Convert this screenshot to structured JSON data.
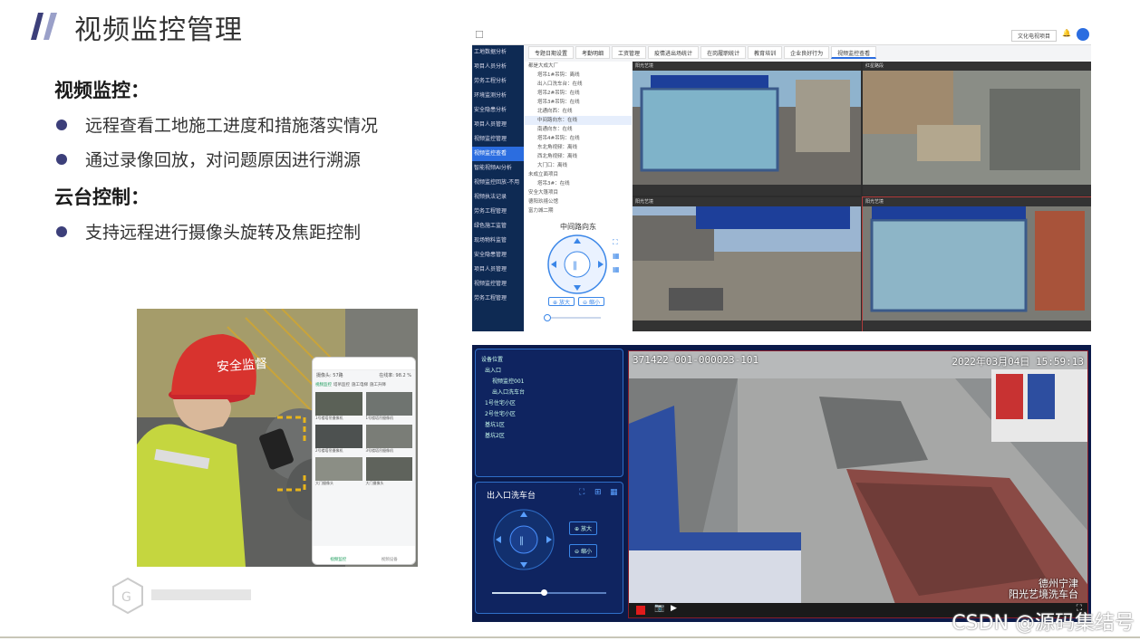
{
  "slide": {
    "title": "视频监控管理",
    "section1": "视频监控：",
    "bullet1": "远程查看工地施工进度和措施落实情况",
    "bullet2": "通过录像回放，对问题原因进行溯源",
    "section2": "云台控制：",
    "bullet3": "支持远程进行摄像头旋转及焦距控制",
    "watermark": "CSDN @源码集结号",
    "accent_color": "#3c3f7a"
  },
  "phone_photo": {
    "helmet_text": "安全监督",
    "status": "在线率: 98.2 %",
    "total": "摄像头: 57路",
    "tabs": [
      "视频监控",
      "塔吊监控",
      "施工电梯",
      "施工升降"
    ],
    "thumbs": [
      "1号楼塔吊摄像机",
      "1号楼塔吊摄像机",
      "2号楼塔吊摄像机",
      "3号楼塔吊摄像机",
      "大门摄像头",
      "大门摄像头"
    ],
    "nav": [
      "视频监控",
      "视频设备"
    ]
  },
  "screen1": {
    "user": "文化电视项目",
    "tabs": [
      "专题日期设置",
      "考勤明细",
      "工资管理",
      "疫情进出场统计",
      "在岗履职统计",
      "教育培训",
      "企业良好行为",
      "视频监控查看"
    ],
    "sidebar": [
      "工地数据分析",
      "项目人员分析",
      "劳务工程分析",
      "环境监测分析",
      "安全隐患分析",
      "项目人员管理",
      "视频监控管理",
      "视频监控查看",
      "智能视频AI分析",
      "视频监控回放-不用",
      "视频执法记录",
      "劳务工程管理",
      "绿色施工监管",
      "现场物料监管",
      "安全隐患管理",
      "项目人员管理",
      "视频监控管理",
      "劳务工程管理"
    ],
    "tree": [
      "都是大成大厂",
      "塔吊1#吊钩：离线",
      "出入口洗车台：在线",
      "塔吊2#吊钩：在线",
      "塔吊3#吊钩：在线",
      "北通向西：在线",
      "中间路向东：在线",
      "南通向东：在线",
      "塔吊4#吊钩：在线",
      "东北角视频：离线",
      "西北角视频：离线",
      "大门口：离线",
      "未成立面项目",
      "塔吊3#：在线",
      "安全大篷项目",
      "德阳玖禧公馆",
      "富力城二期"
    ],
    "ptz_title": "中间路向东",
    "zoom_in": "放大",
    "zoom_out": "缩小",
    "cams": [
      {
        "name": "阳光艺境",
        "foot": "码流"
      },
      {
        "name": "红星路段",
        "foot": "码流"
      },
      {
        "name": "阳光艺境",
        "foot": "码流"
      },
      {
        "name": "阳光艺境",
        "foot": "码流"
      }
    ]
  },
  "screen2": {
    "tree_title": "设备位置",
    "tree": [
      "出入口",
      "视频监控001",
      "出入口洗车台",
      "1号住宅小区",
      "2号住宅小区",
      "基坑1区",
      "基坑2区"
    ],
    "ptz_title": "出入口洗车台",
    "zoom_in": "放大",
    "zoom_out": "缩小",
    "video_id": "371422-001-000023-101",
    "video_time": "2022年03月04日 15:59:13",
    "video_label1": "德州宁津",
    "video_label2": "阳光艺境洗车台",
    "slider_value": 0.45
  }
}
